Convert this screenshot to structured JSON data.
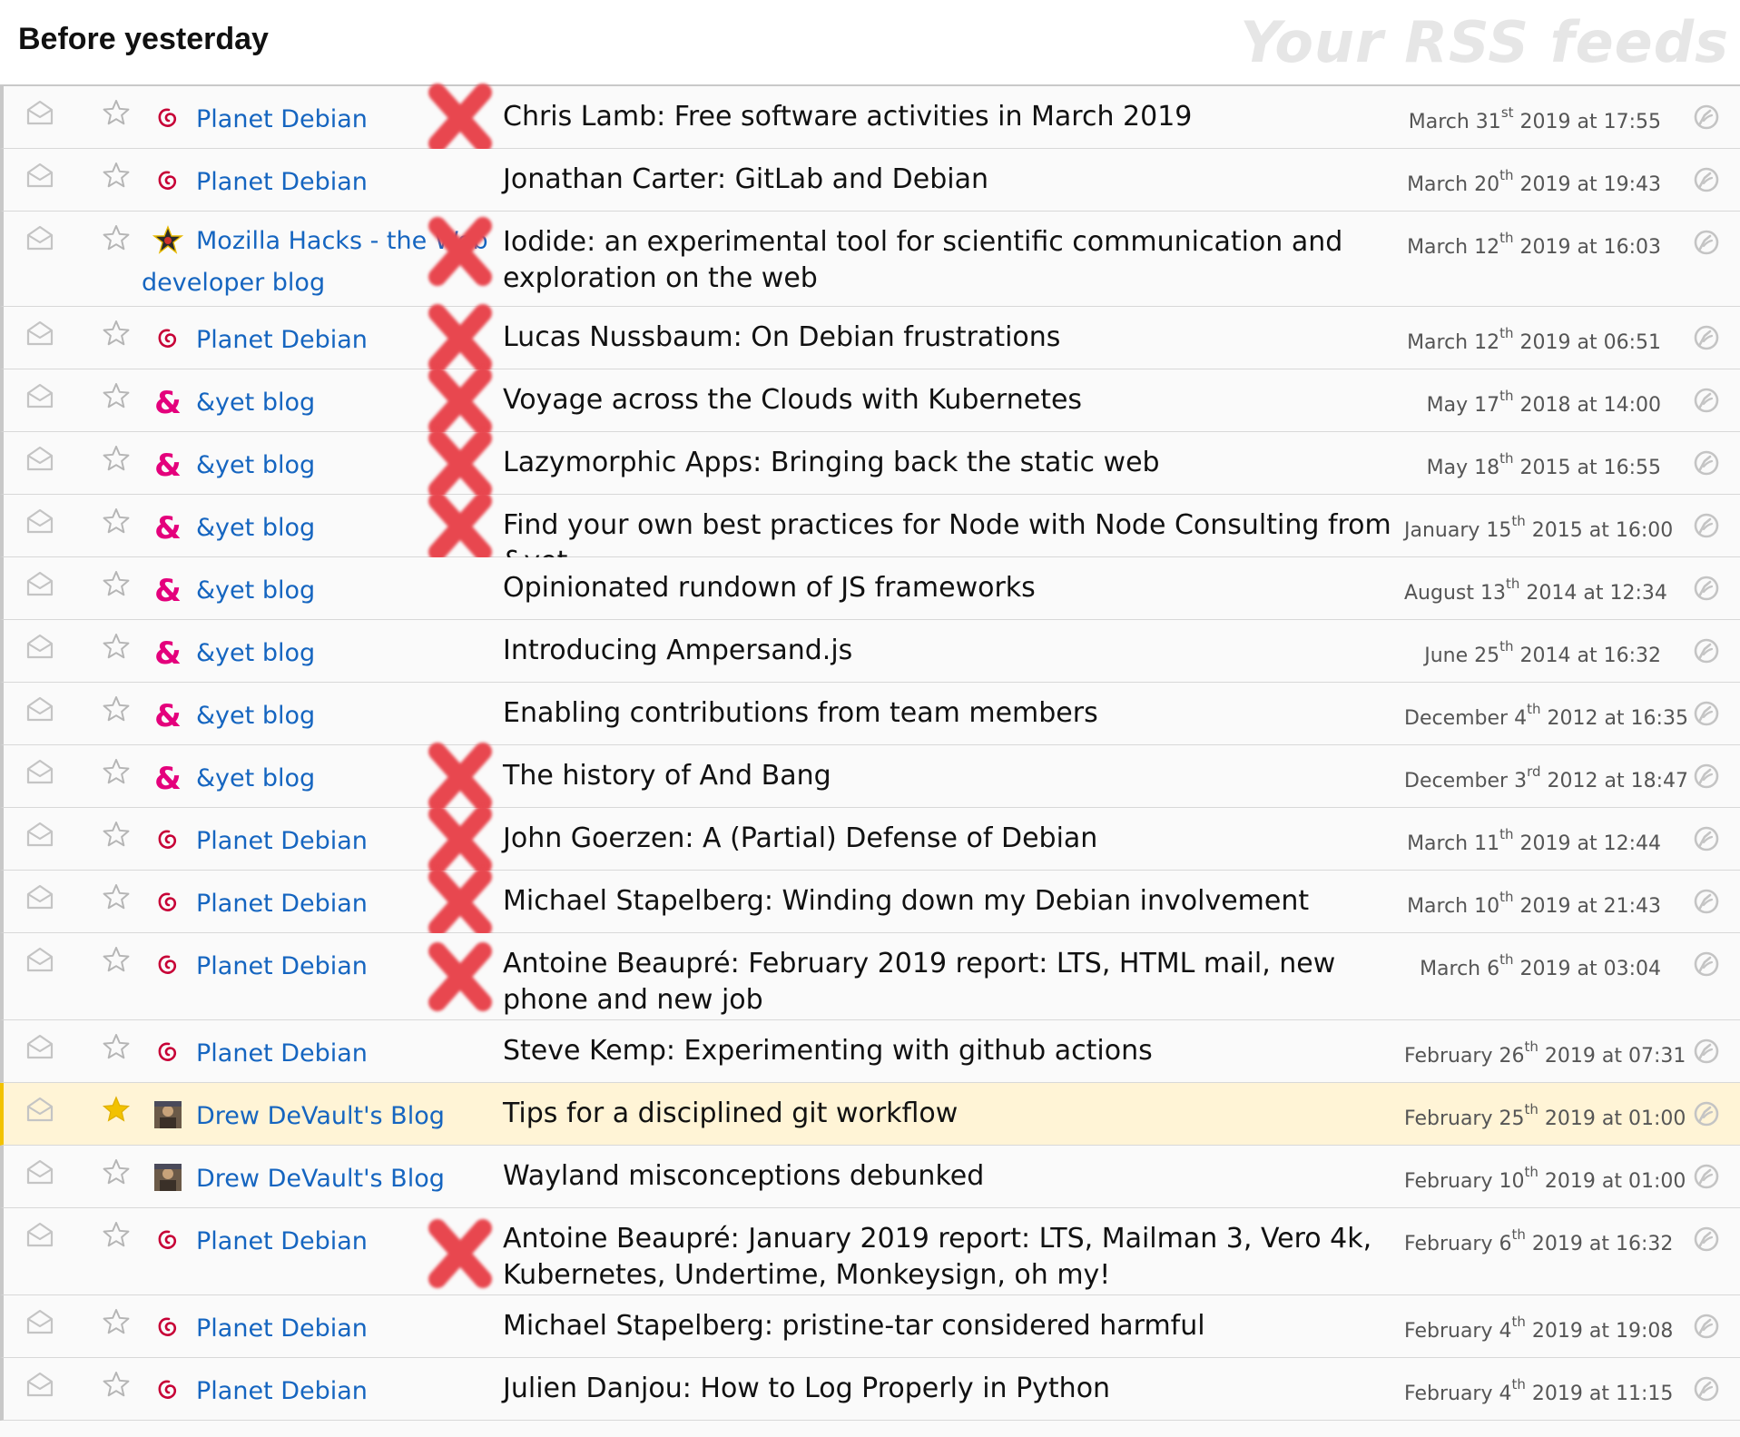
{
  "header": {
    "day_title": "Before yesterday",
    "app_title": "Your RSS feeds"
  },
  "colors": {
    "link_blue": "#1565c0",
    "debian_red": "#c70036",
    "yet_pink": "#e4007c",
    "highlight": "#fff4d6",
    "star_gold": "#f2c200",
    "cross_red": "#e8474f"
  },
  "rows": [
    {
      "feed": "Planet Debian",
      "icon": "debian-swirl-icon",
      "title": "Chris Lamb: Free software activities in March 2019",
      "date_pre": "March 31",
      "date_sup": "st",
      "date_post": " 2019 at 17:55",
      "crossed": true,
      "starred": false
    },
    {
      "feed": "Planet Debian",
      "icon": "debian-swirl-icon",
      "title": "Jonathan Carter: GitLab and Debian",
      "date_pre": "March 20",
      "date_sup": "th",
      "date_post": " 2019 at 19:43",
      "crossed": false,
      "starred": false
    },
    {
      "feed_line1": "Mozilla Hacks - the Web",
      "feed_line2": "developer blog",
      "icon": "mozilla-star-icon",
      "title": "Iodide: an experimental tool for scientific communication and exploration on the web",
      "date_pre": "March 12",
      "date_sup": "th",
      "date_post": " 2019 at 16:03",
      "crossed": true,
      "starred": false
    },
    {
      "feed": "Planet Debian",
      "icon": "debian-swirl-icon",
      "title": "Lucas Nussbaum: On Debian frustrations",
      "date_pre": "March 12",
      "date_sup": "th",
      "date_post": " 2019 at 06:51",
      "crossed": true,
      "starred": false
    },
    {
      "feed": "&yet blog",
      "icon": "ampersand-icon",
      "title": "Voyage across the Clouds with Kubernetes",
      "date_pre": "May 17",
      "date_sup": "th",
      "date_post": " 2018 at 14:00",
      "crossed": true,
      "starred": false
    },
    {
      "feed": "&yet blog",
      "icon": "ampersand-icon",
      "title": "Lazymorphic Apps: Bringing back the static web",
      "date_pre": "May 18",
      "date_sup": "th",
      "date_post": " 2015 at 16:55",
      "crossed": true,
      "starred": false
    },
    {
      "feed": "&yet blog",
      "icon": "ampersand-icon",
      "title": "Find your own best practices for Node with Node Consulting from &yet",
      "date_pre": "January 15",
      "date_sup": "th",
      "date_post": " 2015 at 16:00",
      "crossed": true,
      "starred": false
    },
    {
      "feed": "&yet blog",
      "icon": "ampersand-icon",
      "title": "Opinionated rundown of JS frameworks",
      "date_pre": "August 13",
      "date_sup": "th",
      "date_post": " 2014 at 12:34",
      "crossed": false,
      "starred": false
    },
    {
      "feed": "&yet blog",
      "icon": "ampersand-icon",
      "title": "Introducing Ampersand.js",
      "date_pre": "June 25",
      "date_sup": "th",
      "date_post": " 2014 at 16:32",
      "crossed": false,
      "starred": false
    },
    {
      "feed": "&yet blog",
      "icon": "ampersand-icon",
      "title": "Enabling contributions from team members",
      "date_pre": "December 4",
      "date_sup": "th",
      "date_post": " 2012 at 16:35",
      "crossed": false,
      "starred": false
    },
    {
      "feed": "&yet blog",
      "icon": "ampersand-icon",
      "title": "The history of And Bang",
      "date_pre": "December 3",
      "date_sup": "rd",
      "date_post": " 2012 at 18:47",
      "crossed": true,
      "starred": false
    },
    {
      "feed": "Planet Debian",
      "icon": "debian-swirl-icon",
      "title": "John Goerzen: A (Partial) Defense of Debian",
      "date_pre": "March 11",
      "date_sup": "th",
      "date_post": " 2019 at 12:44",
      "crossed": true,
      "starred": false
    },
    {
      "feed": "Planet Debian",
      "icon": "debian-swirl-icon",
      "title": "Michael Stapelberg: Winding down my Debian involvement",
      "date_pre": "March 10",
      "date_sup": "th",
      "date_post": " 2019 at 21:43",
      "crossed": true,
      "starred": false
    },
    {
      "feed": "Planet Debian",
      "icon": "debian-swirl-icon",
      "title": "Antoine Beaupré: February 2019 report: LTS, HTML mail, new phone and new job",
      "date_pre": "March 6",
      "date_sup": "th",
      "date_post": " 2019 at 03:04",
      "crossed": true,
      "starred": false
    },
    {
      "feed": "Planet Debian",
      "icon": "debian-swirl-icon",
      "title": "Steve Kemp: Experimenting with github actions",
      "date_pre": "February 26",
      "date_sup": "th",
      "date_post": " 2019 at 07:31",
      "crossed": false,
      "starred": false
    },
    {
      "feed": "Drew DeVault's Blog",
      "icon": "avatar-icon",
      "title": "Tips for a disciplined git workflow",
      "date_pre": "February 25",
      "date_sup": "th",
      "date_post": " 2019 at 01:00",
      "crossed": false,
      "starred": true
    },
    {
      "feed": "Drew DeVault's Blog",
      "icon": "avatar-icon",
      "title": "Wayland misconceptions debunked",
      "date_pre": "February 10",
      "date_sup": "th",
      "date_post": " 2019 at 01:00",
      "crossed": false,
      "starred": false
    },
    {
      "feed": "Planet Debian",
      "icon": "debian-swirl-icon",
      "title": "Antoine Beaupré: January 2019 report: LTS, Mailman 3, Vero 4k, Kubernetes, Undertime, Monkeysign, oh my!",
      "date_pre": "February 6",
      "date_sup": "th",
      "date_post": " 2019 at 16:32",
      "crossed": true,
      "starred": false
    },
    {
      "feed": "Planet Debian",
      "icon": "debian-swirl-icon",
      "title": "Michael Stapelberg: pristine-tar considered harmful",
      "date_pre": "February 4",
      "date_sup": "th",
      "date_post": " 2019 at 19:08",
      "crossed": false,
      "starred": false
    },
    {
      "feed": "Planet Debian",
      "icon": "debian-swirl-icon",
      "title": "Julien Danjou: How to Log Properly in Python",
      "date_pre": "February 4",
      "date_sup": "th",
      "date_post": " 2019 at 11:15",
      "crossed": false,
      "starred": false
    }
  ]
}
